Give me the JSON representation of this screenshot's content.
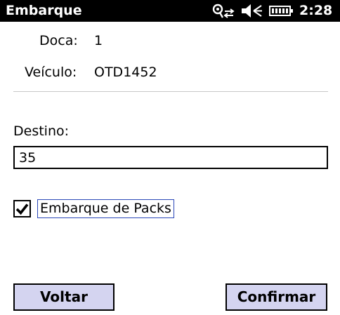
{
  "titlebar": {
    "title": "Embarque",
    "clock": "2:28",
    "icons": [
      "connectivity-icon",
      "speaker-muted-icon",
      "battery-icon"
    ]
  },
  "info": {
    "doca_label": "Doca:",
    "doca_value": "1",
    "veiculo_label": "Veículo:",
    "veiculo_value": "OTD1452"
  },
  "destino": {
    "label": "Destino:",
    "value": "35"
  },
  "packs_checkbox": {
    "label": "Embarque de Packs",
    "checked": true
  },
  "softkeys": {
    "left": "Voltar",
    "right": "Confirmar"
  },
  "colors": {
    "titlebar_bg": "#000000",
    "button_bg": "#d4d4f0",
    "focus_border": "#2b48b8"
  }
}
